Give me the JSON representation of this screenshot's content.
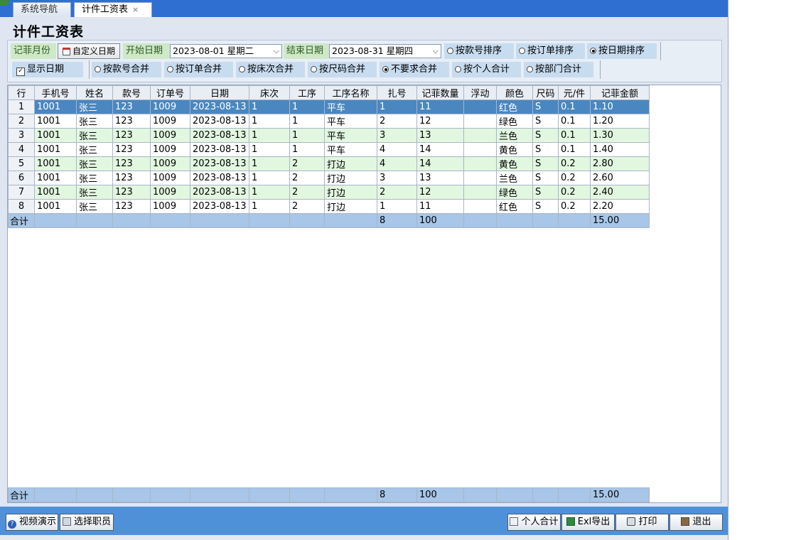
{
  "tabs": {
    "nav_label": "系统导航",
    "active_label": "计件工资表",
    "close_glyph": "×"
  },
  "page_title": "计件工资表",
  "toolbar": {
    "month_label": "记菲月份",
    "custom_date_btn": "自定义日期",
    "start_label": "开始日期",
    "start_value": "2023-08-01 星期二",
    "end_label": "结束日期",
    "end_value": "2023-08-31 星期四",
    "sort_options": [
      {
        "label": "按款号排序",
        "checked": false
      },
      {
        "label": "按订单排序",
        "checked": false
      },
      {
        "label": "按日期排序",
        "checked": true
      }
    ],
    "show_date_label": "显示日期",
    "show_date_checked": true,
    "merge_options": [
      {
        "label": "按款号合并",
        "checked": false
      },
      {
        "label": "按订单合并",
        "checked": false
      },
      {
        "label": "按床次合并",
        "checked": false
      },
      {
        "label": "按尺码合并",
        "checked": false
      },
      {
        "label": "不要求合并",
        "checked": true
      },
      {
        "label": "按个人合计",
        "checked": false
      },
      {
        "label": "按部门合计",
        "checked": false
      }
    ]
  },
  "grid": {
    "columns": [
      "行",
      "手机号",
      "姓名",
      "款号",
      "订单号",
      "日期",
      "床次",
      "工序",
      "工序名称",
      "扎号",
      "记菲数量",
      "浮动",
      "颜色",
      "尺码",
      "元/件",
      "记菲金额"
    ],
    "rows": [
      [
        "1",
        "1001",
        "张三",
        "123",
        "1009",
        "2023-08-13",
        "1",
        "1",
        "平车",
        "1",
        "11",
        "",
        "红色",
        "S",
        "0.1",
        "1.10"
      ],
      [
        "2",
        "1001",
        "张三",
        "123",
        "1009",
        "2023-08-13",
        "1",
        "1",
        "平车",
        "2",
        "12",
        "",
        "绿色",
        "S",
        "0.1",
        "1.20"
      ],
      [
        "3",
        "1001",
        "张三",
        "123",
        "1009",
        "2023-08-13",
        "1",
        "1",
        "平车",
        "3",
        "13",
        "",
        "兰色",
        "S",
        "0.1",
        "1.30"
      ],
      [
        "4",
        "1001",
        "张三",
        "123",
        "1009",
        "2023-08-13",
        "1",
        "1",
        "平车",
        "4",
        "14",
        "",
        "黄色",
        "S",
        "0.1",
        "1.40"
      ],
      [
        "5",
        "1001",
        "张三",
        "123",
        "1009",
        "2023-08-13",
        "1",
        "2",
        "打边",
        "4",
        "14",
        "",
        "黄色",
        "S",
        "0.2",
        "2.80"
      ],
      [
        "6",
        "1001",
        "张三",
        "123",
        "1009",
        "2023-08-13",
        "1",
        "2",
        "打边",
        "3",
        "13",
        "",
        "兰色",
        "S",
        "0.2",
        "2.60"
      ],
      [
        "7",
        "1001",
        "张三",
        "123",
        "1009",
        "2023-08-13",
        "1",
        "2",
        "打边",
        "2",
        "12",
        "",
        "绿色",
        "S",
        "0.2",
        "2.40"
      ],
      [
        "8",
        "1001",
        "张三",
        "123",
        "1009",
        "2023-08-13",
        "1",
        "2",
        "打边",
        "1",
        "11",
        "",
        "红色",
        "S",
        "0.2",
        "2.20"
      ]
    ],
    "selected_row": 0,
    "summary": [
      "合计",
      "",
      "",
      "",
      "",
      "",
      "",
      "",
      "",
      "8",
      "100",
      "",
      "",
      "",
      "",
      "15.00"
    ]
  },
  "bottom_buttons": {
    "video": "视频演示",
    "select_staff": "选择职员",
    "personal_total": "个人合计",
    "export": "Exl导出",
    "print": "打印",
    "exit": "退出"
  },
  "colors": {
    "tabbar": "#2f6fd1",
    "selected_row": "#4a87c0",
    "alt_row": "#e2f7df",
    "summary_row": "#a7c6e8",
    "bottombar": "#4f91d9"
  }
}
